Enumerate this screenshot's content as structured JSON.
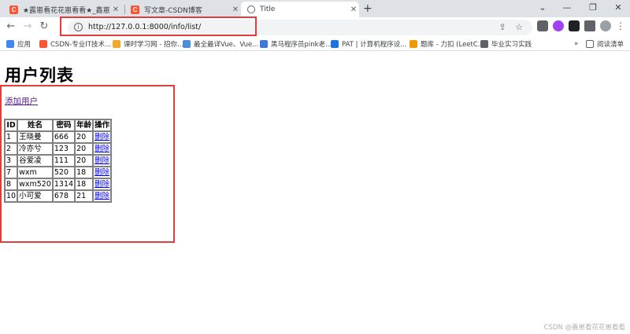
{
  "tabs": [
    {
      "title": "★露崽看花花崽看看★_鑫崽看花",
      "favicon": "csdn-icon",
      "active": false
    },
    {
      "title": "写文章-CSDN博客",
      "favicon": "csdn-icon",
      "active": false
    },
    {
      "title": "Title",
      "favicon": "globe-icon",
      "active": true
    }
  ],
  "window_controls": {
    "minimize": "—",
    "maximize": "❐",
    "close": "✕",
    "tab_search": "⌄"
  },
  "toolbar": {
    "url": "http://127.0.0.1:8000/info/list/",
    "back": "←",
    "forward": "→",
    "reload": "↻",
    "share": "⇪",
    "star": "☆"
  },
  "bookmarks": [
    {
      "label": "应用",
      "color": "#4285f4"
    },
    {
      "label": "CSDN-专业IT技术...",
      "color": "#fc5531"
    },
    {
      "label": "课时学习网 - 招你...",
      "color": "#f6a623"
    },
    {
      "label": "最全最详Vue、Vue...",
      "color": "#4a90d9"
    },
    {
      "label": "黑马程序员pink老...",
      "color": "#3c78d8"
    },
    {
      "label": "PAT | 计算机程序设...",
      "color": "#1a73e8"
    },
    {
      "label": "题库 - 力扣 (LeetC...",
      "color": "#f29900"
    },
    {
      "label": "毕业实习实践",
      "color": "#5f6368"
    }
  ],
  "bookmarks_more": "»",
  "reading_list": "阅读清单",
  "page": {
    "title": "用户列表",
    "add_link": "添加用户",
    "columns": [
      "ID",
      "姓名",
      "密码",
      "年龄",
      "操作"
    ],
    "rows": [
      {
        "id": "1",
        "name": "王晓曼",
        "password": "666",
        "age": "20",
        "action": "删除"
      },
      {
        "id": "2",
        "name": "冷亦兮",
        "password": "123",
        "age": "20",
        "action": "删除"
      },
      {
        "id": "3",
        "name": "谷爱凌",
        "password": "111",
        "age": "20",
        "action": "删除"
      },
      {
        "id": "7",
        "name": "wxm",
        "password": "520",
        "age": "18",
        "action": "删除"
      },
      {
        "id": "8",
        "name": "wxm520",
        "password": "1314",
        "age": "18",
        "action": "删除"
      },
      {
        "id": "10",
        "name": "小可爱",
        "password": "678",
        "age": "21",
        "action": "删除"
      }
    ]
  },
  "watermark": "CSDN @鑫崽看花花崽看看"
}
